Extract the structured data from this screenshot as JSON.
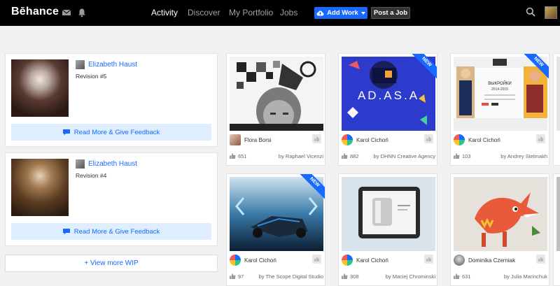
{
  "topbar": {
    "logo": "Bēhance",
    "nav": [
      "Activity",
      "Discover",
      "My Portfolio",
      "Jobs"
    ],
    "add_work": "Add Work",
    "post_job": "Post a Job"
  },
  "wip": [
    {
      "author": "Elizabeth Haust",
      "revision": "Revision #5",
      "feedback": "Read More & Give Feedback"
    },
    {
      "author": "Elizabeth Haust",
      "revision": "Revision #4",
      "feedback": "Read More & Give Feedback"
    }
  ],
  "view_more": "+ View more WIP",
  "projects": [
    {
      "owner": "Flora Borsi",
      "likes": "651",
      "by": "by  Raphael Vicenzi",
      "new": false
    },
    {
      "owner": "Karol Cichoń",
      "likes": "882",
      "by": "by  DHNN Creative Agency",
      "new": true,
      "badge": "NEW"
    },
    {
      "owner": "Karol Cichoń",
      "likes": "103",
      "by": "by  Andrey Stelmakh",
      "new": true,
      "badge": "NEW"
    },
    {
      "owner": "Karol Cichoń",
      "likes": "97",
      "by": "by  The Scope Digital Studio",
      "new": true,
      "badge": "NEW"
    },
    {
      "owner": "Karol Cichoń",
      "likes": "308",
      "by": "by  Maciej Chrominski",
      "new": false
    },
    {
      "owner": "Dominika Czerniak",
      "likes": "631",
      "by": "by  Julia Marinchuk",
      "new": false
    }
  ],
  "store_mockup": {
    "title": "ВЫКРОЙКИ",
    "subtitle": "2014-2015"
  },
  "brand_tile_text": "AD.AS.A",
  "colors": {
    "accent": "#1769ff",
    "topbar": "#000000",
    "page_bg": "#f1f1f1"
  }
}
